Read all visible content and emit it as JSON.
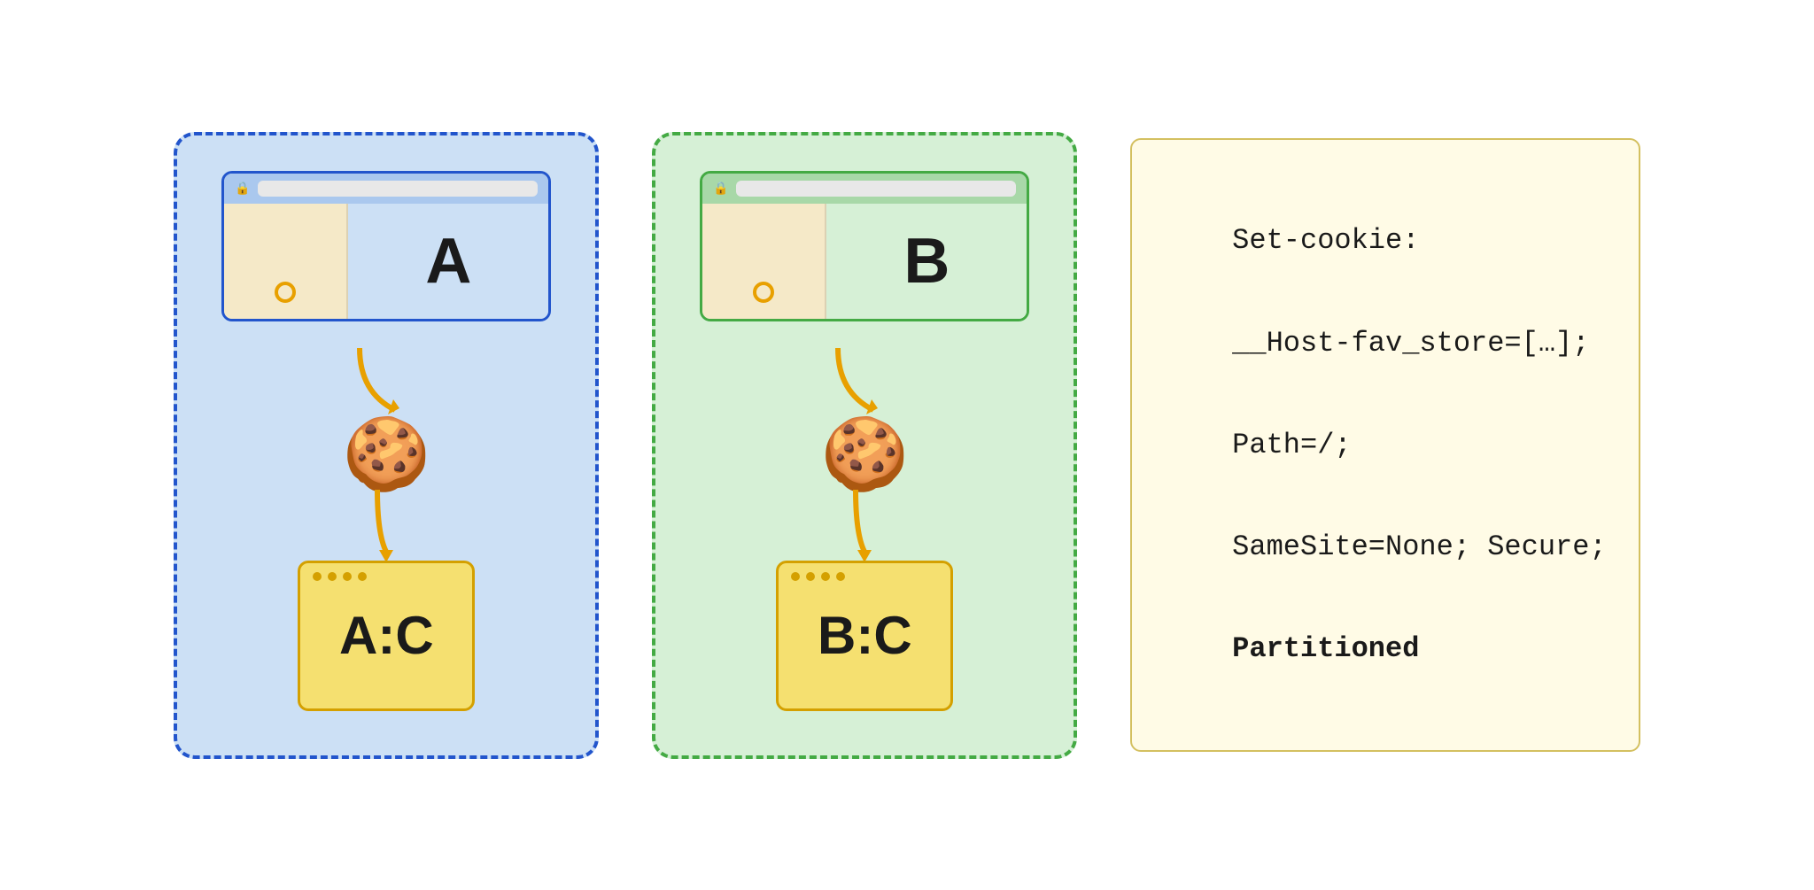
{
  "page": {
    "background": "#ffffff"
  },
  "left_box": {
    "label": "A",
    "storage_label": "A:C",
    "border_color": "#2255cc",
    "bg_color": "#cce0f5",
    "dash_color": "#2255cc"
  },
  "right_box": {
    "label": "B",
    "storage_label": "B:C",
    "border_color": "#44aa44",
    "bg_color": "#d6f0d6",
    "dash_color": "#44aa44"
  },
  "code_block": {
    "line1": "Set-cookie:",
    "line2": "__Host-fav_store=[…];",
    "line3": "Path=/;",
    "line4": "SameSite=None; Secure;",
    "line5_bold": "Partitioned"
  },
  "icons": {
    "lock": "🔒",
    "cookie": "🍪"
  }
}
